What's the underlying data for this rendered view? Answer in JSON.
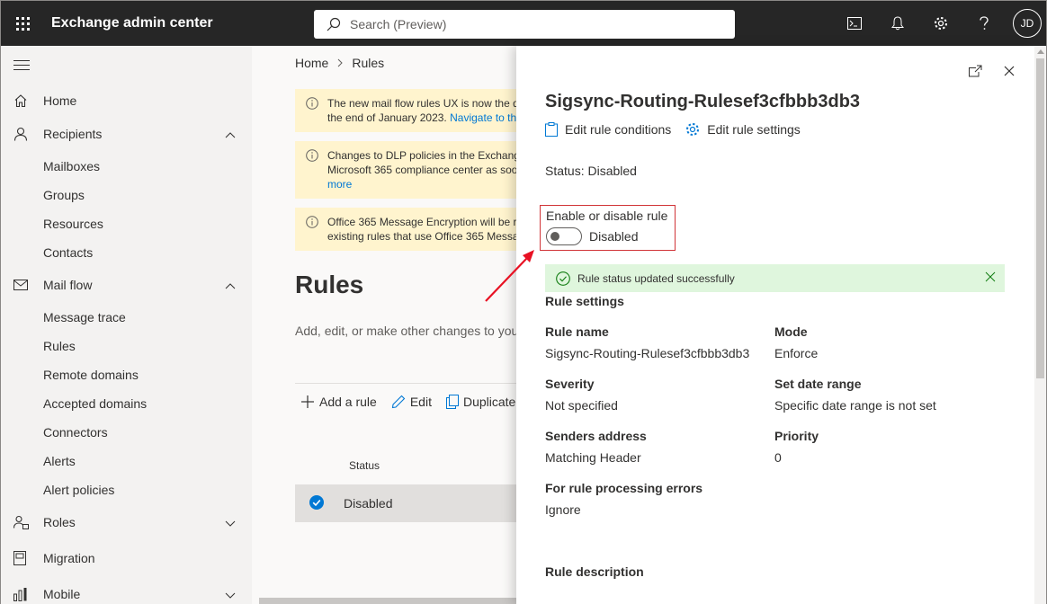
{
  "topbar": {
    "app_title": "Exchange admin center",
    "search_placeholder": "Search (Preview)",
    "avatar_initials": "JD",
    "icons": [
      "terminal-icon",
      "bell-icon",
      "gear-icon",
      "help-icon"
    ]
  },
  "sidebar": {
    "items": [
      {
        "label": "Home",
        "icon": "home-icon"
      },
      {
        "label": "Recipients",
        "icon": "person-icon",
        "expanded": true,
        "children": [
          "Mailboxes",
          "Groups",
          "Resources",
          "Contacts"
        ]
      },
      {
        "label": "Mail flow",
        "icon": "mail-icon",
        "expanded": true,
        "children": [
          "Message trace",
          "Rules",
          "Remote domains",
          "Accepted domains",
          "Connectors",
          "Alerts",
          "Alert policies"
        ]
      },
      {
        "label": "Roles",
        "icon": "roles-icon",
        "expanded": false
      },
      {
        "label": "Migration",
        "icon": "migration-icon"
      },
      {
        "label": "Mobile",
        "icon": "mobile-icon",
        "expanded": false
      }
    ]
  },
  "main": {
    "breadcrumb": [
      "Home",
      "Rules"
    ],
    "banners": [
      {
        "line1": "The new mail flow rules UX is now the d",
        "line2": "the end of January 2023.",
        "link": "Navigate to th"
      },
      {
        "line1": "Changes to DLP policies in the Exchange",
        "line2": "Microsoft 365 compliance center as soo",
        "link": "more"
      },
      {
        "line1": "Office 365 Message Encryption will be re",
        "line2": "existing rules that use Office 365 Messa"
      }
    ],
    "title": "Rules",
    "description": "Add, edit, or make other changes to you",
    "commands": {
      "add": "Add a rule",
      "edit": "Edit",
      "duplicate": "Duplicate"
    },
    "table": {
      "column_status": "Status",
      "row_status": "Disabled"
    }
  },
  "panel": {
    "title": "Sigsync-Routing-Rulesef3cfbbb3db3",
    "actions": {
      "edit_conditions": "Edit rule conditions",
      "edit_settings": "Edit rule settings"
    },
    "status": "Status: Disabled",
    "toggle": {
      "label": "Enable or disable rule",
      "state": "Disabled",
      "on": false
    },
    "success_message": "Rule status updated successfully",
    "settings_title": "Rule settings",
    "fields": {
      "rule_name": {
        "label": "Rule name",
        "value": "Sigsync-Routing-Rulesef3cfbbb3db3"
      },
      "mode": {
        "label": "Mode",
        "value": "Enforce"
      },
      "severity": {
        "label": "Severity",
        "value": "Not specified"
      },
      "date_range": {
        "label": "Set date range",
        "value": "Specific date range is not set"
      },
      "senders": {
        "label": "Senders address",
        "value": "Matching Header"
      },
      "priority": {
        "label": "Priority",
        "value": "0"
      },
      "errors": {
        "label": "For rule processing errors",
        "value": "Ignore"
      }
    },
    "description_title": "Rule description"
  },
  "colors": {
    "topbar": "#262626",
    "accent": "#0078d4",
    "highlight": "#d13438",
    "success": "#dff6dd",
    "warning": "#fff4ce"
  }
}
